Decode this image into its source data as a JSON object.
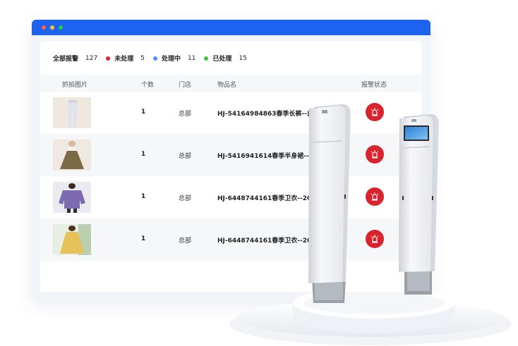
{
  "summary": {
    "total_label": "全部报警",
    "total_count": "127",
    "unprocessed_label": "未处理",
    "unprocessed_count": "5",
    "processing_label": "处理中",
    "processing_count": "11",
    "processed_label": "已处理",
    "processed_count": "15"
  },
  "table": {
    "columns": [
      "抓拍图片",
      "个数",
      "门店",
      "物品名",
      "报警状态"
    ],
    "rows": [
      {
        "count": "1",
        "store": "总部",
        "item": "HJ-54164984863春季长裤--白色"
      },
      {
        "count": "1",
        "store": "总部",
        "item": "HJ-5416941614春季半身裙--2022"
      },
      {
        "count": "1",
        "store": "总部",
        "item": "HJ-6448744161春季卫衣--2022"
      },
      {
        "count": "1",
        "store": "总部",
        "item": "HJ-6448744161春季卫衣--2022"
      }
    ]
  },
  "colors": {
    "titlebar": "#1e63f0",
    "unprocessed": "#e0202a",
    "processing": "#4a90ff",
    "processed": "#3ec43e",
    "alarm": "#d9232d"
  },
  "icons": {
    "alarm": "siren-icon"
  }
}
